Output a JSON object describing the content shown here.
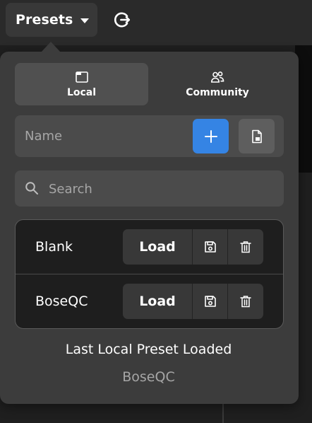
{
  "header": {
    "presets_label": "Presets"
  },
  "tabs": [
    {
      "label": "Local"
    },
    {
      "label": "Community"
    }
  ],
  "name_field": {
    "placeholder": "Name"
  },
  "search": {
    "placeholder": "Search"
  },
  "presets": [
    {
      "name": "Blank",
      "load_label": "Load"
    },
    {
      "name": "BoseQC",
      "load_label": "Load"
    }
  ],
  "status": {
    "label": "Last Local Preset Loaded",
    "value": "BoseQC"
  },
  "colors": {
    "accent": "#3584e4",
    "popup_bg": "#3c3c3c"
  }
}
